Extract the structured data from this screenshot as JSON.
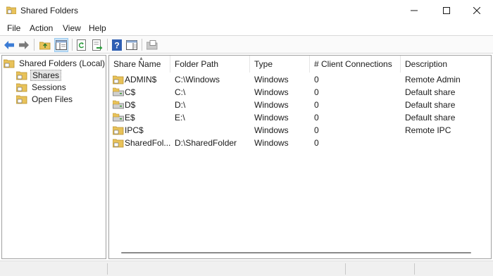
{
  "window": {
    "title": "Shared Folders",
    "controls": [
      "minimize",
      "maximize",
      "close"
    ]
  },
  "menu": [
    "File",
    "Action",
    "View",
    "Help"
  ],
  "toolbar": {
    "buttons": [
      "back-arrow",
      "forward-arrow",
      "up-folder",
      "show-hide-console-tree",
      "refresh",
      "export-list",
      "help",
      "show-hide-action-pane",
      "properties"
    ]
  },
  "tree": {
    "root": "Shared Folders (Local)",
    "items": [
      {
        "label": "Shares",
        "selected": true
      },
      {
        "label": "Sessions",
        "selected": false
      },
      {
        "label": "Open Files",
        "selected": false
      }
    ]
  },
  "list": {
    "columns": [
      "Share Name",
      "Folder Path",
      "Type",
      "# Client Connections",
      "Description"
    ],
    "rows": [
      {
        "name": "ADMIN$",
        "path": "C:\\Windows",
        "type": "Windows",
        "connections": "0",
        "description": "Remote Admin",
        "icon": "share-folder"
      },
      {
        "name": "C$",
        "path": "C:\\",
        "type": "Windows",
        "connections": "0",
        "description": "Default share",
        "icon": "share-drive"
      },
      {
        "name": "D$",
        "path": "D:\\",
        "type": "Windows",
        "connections": "0",
        "description": "Default share",
        "icon": "share-drive"
      },
      {
        "name": "E$",
        "path": "E:\\",
        "type": "Windows",
        "connections": "0",
        "description": "Default share",
        "icon": "share-drive"
      },
      {
        "name": "IPC$",
        "path": "",
        "type": "Windows",
        "connections": "0",
        "description": "Remote IPC",
        "icon": "share-folder"
      },
      {
        "name": "SharedFol...",
        "path": "D:\\SharedFolder",
        "type": "Windows",
        "connections": "0",
        "description": "",
        "icon": "share-folder"
      }
    ]
  },
  "colors": {
    "folder": "#e8c25a",
    "folder_dark": "#b8902a",
    "arrow_blue": "#3a7bd5",
    "help_blue": "#2f5fb3",
    "selection": "#e5e5e5"
  }
}
